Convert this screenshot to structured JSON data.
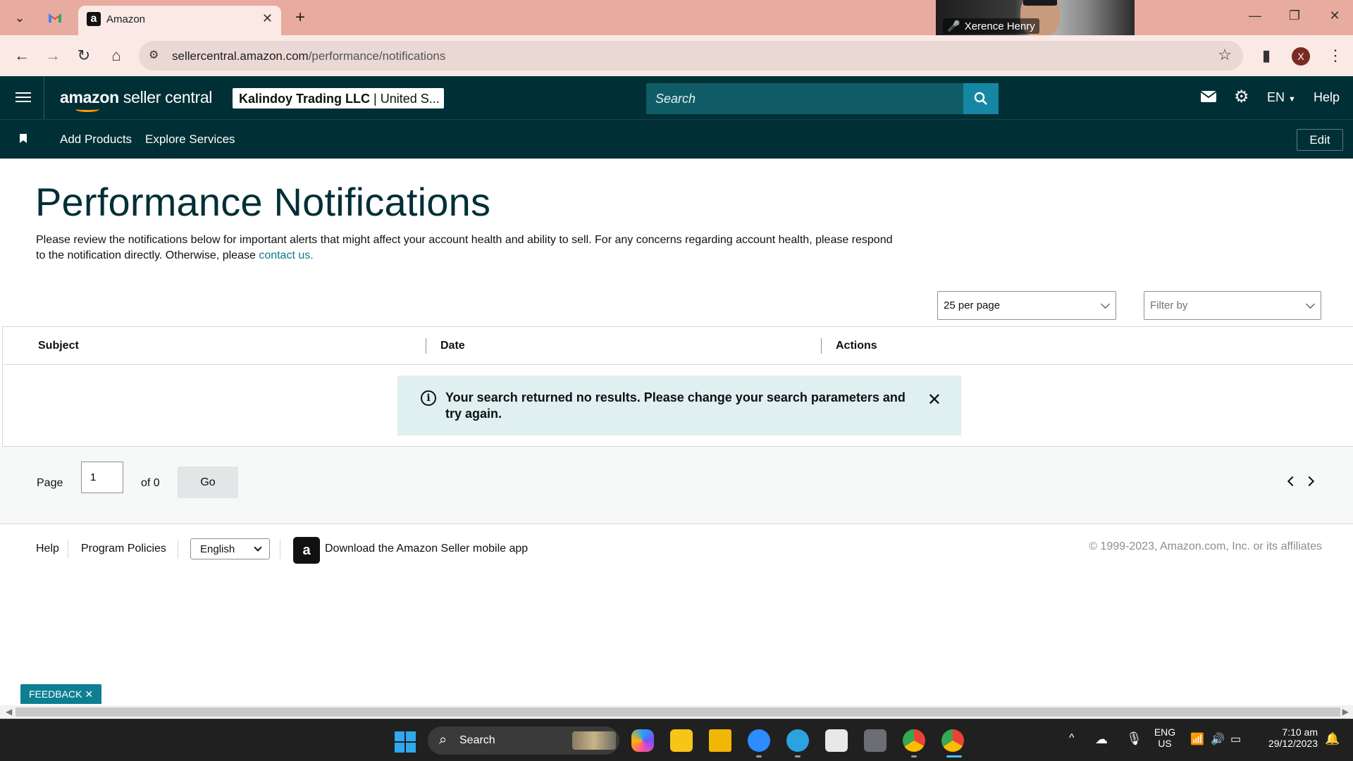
{
  "browser": {
    "tab_title": "Amazon",
    "video_name": "Xerence Henry",
    "url_host": "sellercentral.amazon.com",
    "url_path": "/performance/notifications",
    "profile_initial": "X"
  },
  "header": {
    "logo_bold": "amazon",
    "logo_rest": " seller central",
    "account_bold": "Kalindoy Trading LLC",
    "account_rest": " | United S...",
    "search_placeholder": "Search",
    "language": "EN",
    "help": "Help"
  },
  "subnav": {
    "items": [
      "Add Products",
      "Explore Services"
    ],
    "edit": "Edit"
  },
  "main": {
    "title": "Performance Notifications",
    "description": "Please review the notifications below for important alerts that might affect your account health and ability to sell. For any concerns regarding account health, please respond to the notification directly. Otherwise, please ",
    "contact_link": "contact us.",
    "per_page": "25 per page",
    "filter_placeholder": "Filter by",
    "columns": [
      "Subject",
      "Date",
      "Actions"
    ],
    "alert_message": "Your search returned no results. Please change your search parameters and try again."
  },
  "pager": {
    "page_label": "Page",
    "page_value": "1",
    "of_label": "of 0",
    "go": "Go"
  },
  "footer": {
    "help": "Help",
    "program_policies": "Program Policies",
    "language": "English",
    "app_text": "Download the Amazon Seller mobile app",
    "copyright": "© 1999-2023, Amazon.com, Inc. or its affiliates"
  },
  "feedback": "FEEDBACK",
  "taskbar": {
    "search": "Search",
    "lang_top": "ENG",
    "lang_bottom": "US",
    "time": "7:10 am",
    "date": "29/12/2023"
  },
  "colors": {
    "header_bg": "#002f36",
    "accent_teal": "#0e7f92",
    "alert_bg": "#e0eff0",
    "tab_strip": "#e8aba0"
  }
}
